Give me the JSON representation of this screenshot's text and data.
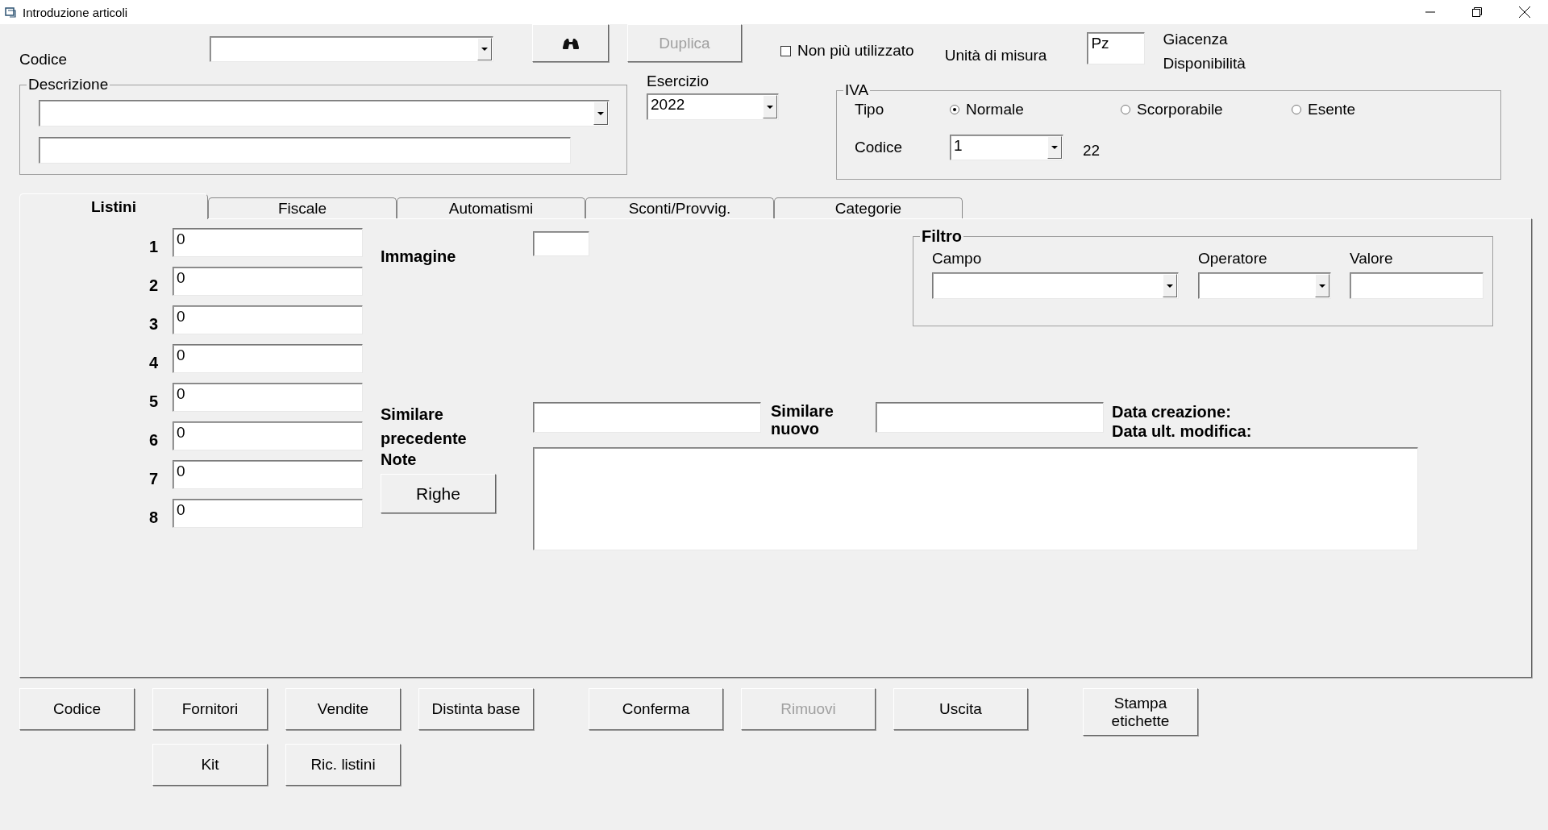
{
  "window": {
    "title": "Introduzione articoli"
  },
  "header": {
    "codice_label": "Codice",
    "duplica": {
      "label": "Duplica",
      "disabled": true
    },
    "non_piu_utilizzato": {
      "label": "Non più utilizzato",
      "checked": false
    },
    "unita_label": "Unità di misura",
    "unita_value": "Pz",
    "giacenza": "Giacenza",
    "disponibilita": "Disponibilità"
  },
  "descrizione": {
    "title": "Descrizione"
  },
  "esercizio": {
    "label": "Esercizio",
    "value": "2022"
  },
  "iva": {
    "title": "IVA",
    "tipo_label": "Tipo",
    "options": [
      {
        "label": "Normale",
        "selected": true
      },
      {
        "label": "Scorporabile",
        "selected": false
      },
      {
        "label": "Esente",
        "selected": false
      }
    ],
    "codice_label": "Codice",
    "codice_value": "1",
    "rate": "22"
  },
  "tabs": [
    {
      "label": "Listini",
      "selected": true
    },
    {
      "label": "Fiscale",
      "selected": false
    },
    {
      "label": "Automatismi",
      "selected": false
    },
    {
      "label": "Sconti/Provvig.",
      "selected": false
    },
    {
      "label": "Categorie",
      "selected": false
    }
  ],
  "listini": [
    {
      "number": "1",
      "value": "0"
    },
    {
      "number": "2",
      "value": "0"
    },
    {
      "number": "3",
      "value": "0"
    },
    {
      "number": "4",
      "value": "0"
    },
    {
      "number": "5",
      "value": "0"
    },
    {
      "number": "6",
      "value": "0"
    },
    {
      "number": "7",
      "value": "0"
    },
    {
      "number": "8",
      "value": "0"
    }
  ],
  "immagine": "Immagine",
  "filtro": {
    "title": "Filtro",
    "campo": "Campo",
    "operatore": "Operatore",
    "valore": "Valore"
  },
  "similare_precedente": "Similare precedente",
  "similare_nuovo": "Similare nuovo",
  "data_creazione": "Data creazione:",
  "data_modifica": "Data ult. modifica:",
  "note": "Note",
  "righe": "Righe",
  "button_groups": [
    [
      {
        "label": "Codice",
        "disabled": false
      },
      {
        "label": "Fornitori",
        "disabled": false
      },
      {
        "label": "Vendite",
        "disabled": false
      },
      {
        "label": "Distinta base",
        "disabled": false
      }
    ],
    [
      {
        "label": "Conferma",
        "disabled": false
      },
      {
        "label": "Rimuovi",
        "disabled": true
      },
      {
        "label": "Uscita",
        "disabled": false
      }
    ],
    [
      {
        "label": "Stampa etichette",
        "disabled": false
      }
    ]
  ],
  "buttons_row2": [
    {
      "label": "Kit",
      "disabled": false
    },
    {
      "label": "Ric. listini",
      "disabled": false
    }
  ]
}
